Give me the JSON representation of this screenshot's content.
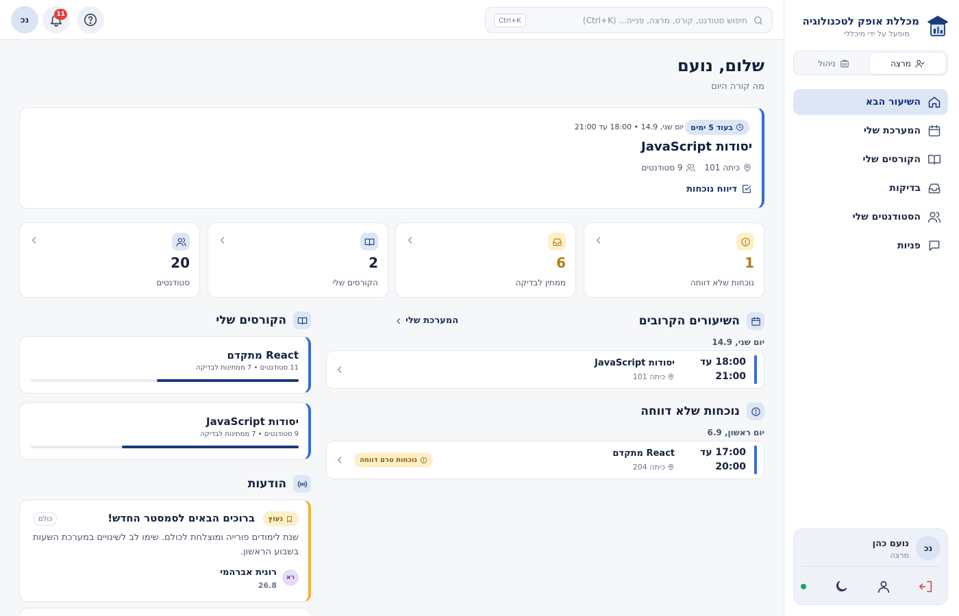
{
  "brand": {
    "name": "מכללת אופק לטכנולוגיה",
    "subtitle": "מופעל על ידי מיכללי"
  },
  "role_switch": {
    "active": "מרצה",
    "other": "ניהול"
  },
  "nav": {
    "items": [
      {
        "label": "השיעור הבא",
        "icon": "home-icon",
        "active": true
      },
      {
        "label": "המערכת שלי",
        "icon": "calendar-icon"
      },
      {
        "label": "הקורסים שלי",
        "icon": "book-icon"
      },
      {
        "label": "בדיקות",
        "icon": "inbox-icon"
      },
      {
        "label": "הסטודנטים שלי",
        "icon": "users-icon"
      },
      {
        "label": "פניות",
        "icon": "message-icon"
      }
    ]
  },
  "user": {
    "name": "נועם כהן",
    "role": "מרצה",
    "initials": "נכ",
    "status_color": "#22a060"
  },
  "topbar": {
    "search_placeholder": "חיפוש סטודנט, קורס, מרצה, פנייה... (Ctrl+K)",
    "shortcut": "Ctrl+K",
    "notifications_count": "11",
    "initials": "נכ"
  },
  "greeting": {
    "title": "שלום, נועם",
    "subtitle": "מה קורה היום"
  },
  "next_lesson": {
    "badge": "בעוד 5 ימים",
    "time": "יום שני, 14.9 • 18:00 עד 21:00",
    "title": "יסודות JavaScript",
    "room": "כיתה 101",
    "students": "9 סטודנטים",
    "action": "דיווח נוכחות",
    "accent": "#2f6fd6"
  },
  "stats": [
    {
      "value": "1",
      "label": "נוכחות שלא דווחה",
      "tone": "amber",
      "icon": "alert-circle-icon"
    },
    {
      "value": "6",
      "label": "ממתין לבדיקה",
      "tone": "amber",
      "icon": "inbox-icon"
    },
    {
      "value": "2",
      "label": "הקורסים שלי",
      "tone": "blue",
      "icon": "book-icon"
    },
    {
      "value": "20",
      "label": "סטודנטים",
      "tone": "blue",
      "icon": "users-icon"
    }
  ],
  "upcoming": {
    "title": "השיעורים הקרובים",
    "link": "המערכת שלי",
    "day": "יום שני, 14.9",
    "lesson": {
      "start": "18:00 עד",
      "end": "21:00",
      "title": "יסודות JavaScript",
      "room": "כיתה 101"
    }
  },
  "unreported": {
    "title": "נוכחות שלא דווחה",
    "day": "יום ראשון, 6.9",
    "lesson": {
      "start": "17:00 עד",
      "end": "20:00",
      "title": "React מתקדם",
      "room": "כיתה 204",
      "status": "נוכחות טרם דווחה"
    }
  },
  "my_courses": {
    "title": "הקורסים שלי",
    "items": [
      {
        "title": "React מתקדם",
        "meta": "11 סטודנטים • 7 ממתינות לבדיקה",
        "progress": 0.53
      },
      {
        "title": "יסודות JavaScript",
        "meta": "9 סטודנטים • 7 ממתינות לבדיקה",
        "progress": 0.66
      }
    ]
  },
  "announcements": {
    "title": "הודעות",
    "item": {
      "pin": "נעוץ",
      "title": "ברוכים הבאים לסמסטר החדש!",
      "audience": "כולם",
      "body": "שנת לימודים פורייה ומוצלחת לכולם. שימו לב לשינויים במערכת השעות בשבוע הראשון.",
      "author_initials": "רא",
      "author": "רונית אברהמי",
      "date": "26.8"
    }
  }
}
